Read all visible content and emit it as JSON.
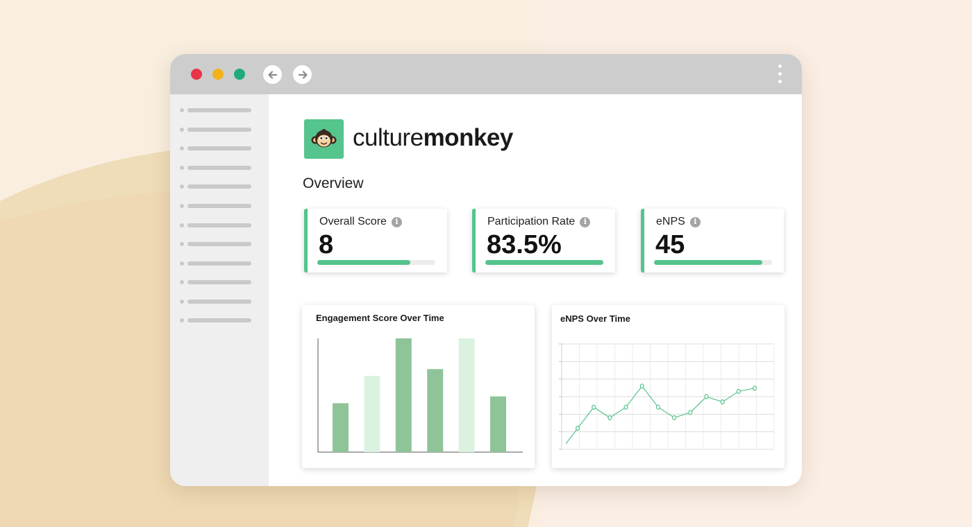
{
  "browser": {
    "icons": [
      "close-dot",
      "minimize-dot",
      "maximize-dot",
      "back-arrow-icon",
      "forward-arrow-icon",
      "kebab-menu-icon"
    ]
  },
  "brand": {
    "name_light": "culture",
    "name_bold": "monkey",
    "logo_icon": "monkey-face-icon",
    "accent_color": "#55c48d"
  },
  "page": {
    "heading": "Overview"
  },
  "metrics": [
    {
      "title": "Overall Score",
      "value": "8",
      "progress": 0.79
    },
    {
      "title": "Participation Rate",
      "value": "83.5%",
      "progress": 1.0
    },
    {
      "title": "eNPS",
      "value": "45",
      "progress": 0.92
    }
  ],
  "chart_data": [
    {
      "type": "bar",
      "title": "Engagement Score Over Time",
      "categories": [
        "",
        "",
        "",
        "",
        "",
        ""
      ],
      "values": [
        43,
        67,
        100,
        73,
        100,
        49
      ],
      "colors": [
        "#8fc498",
        "#dcf2e1",
        "#8fc498",
        "#8fc498",
        "#dcf2e1",
        "#8fc498"
      ],
      "ylim": [
        0,
        100
      ]
    },
    {
      "type": "line",
      "title": "eNPS Over Time",
      "x": [
        0,
        1,
        2,
        3,
        4,
        5,
        6,
        7,
        8,
        9,
        10,
        11
      ],
      "values": [
        2,
        4,
        3,
        4,
        6,
        4,
        3,
        3.5,
        5,
        4.5,
        5.5,
        5.8
      ],
      "series_color": "#55c48d",
      "ylim": [
        0,
        10
      ],
      "grid": true
    }
  ]
}
